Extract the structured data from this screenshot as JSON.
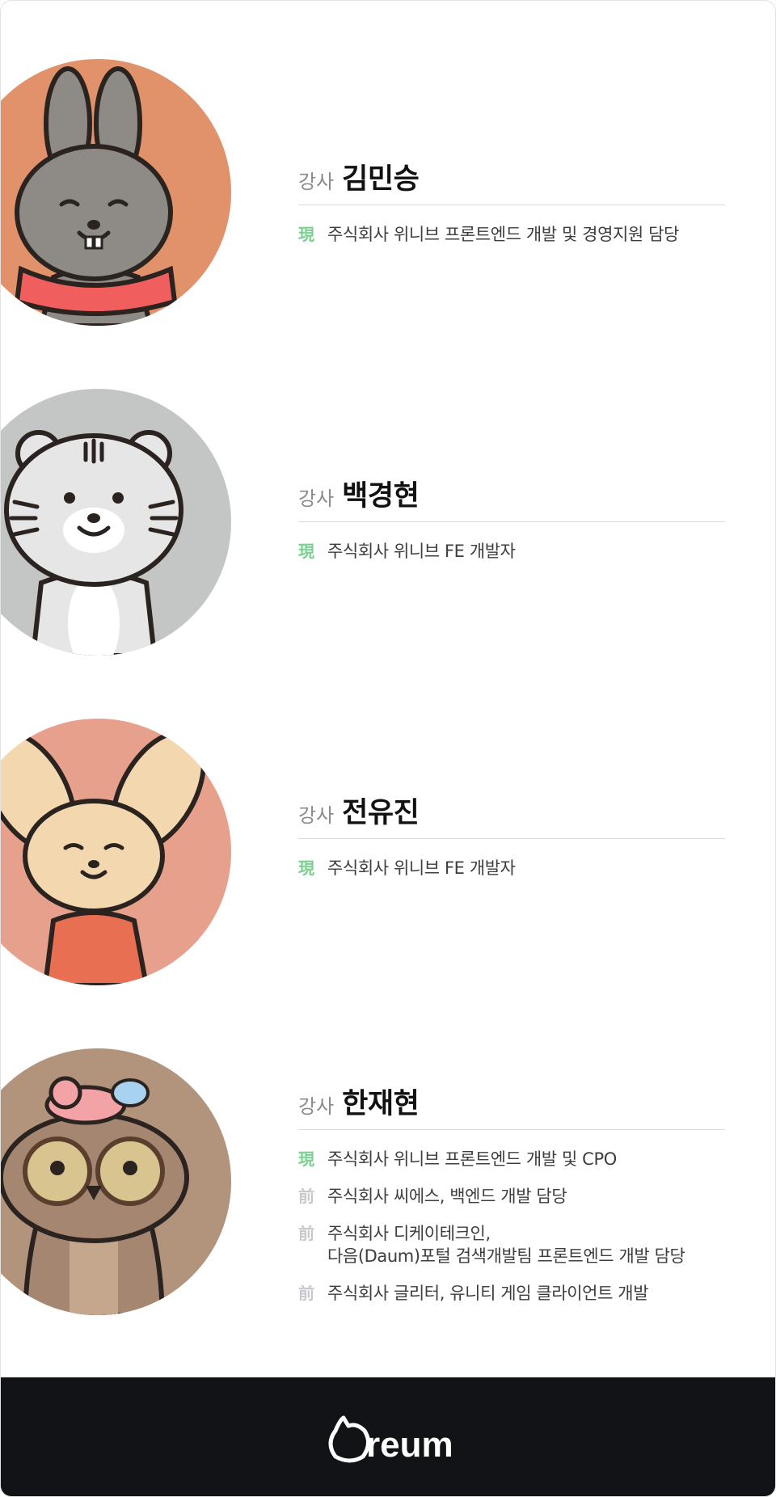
{
  "instructors": [
    {
      "role": "강사",
      "name": "김민승",
      "avatar": "rabbit-avatar",
      "careers": [
        {
          "mark": "現",
          "type": "current",
          "text": "주식회사 위니브 프론트엔드 개발 및 경영지원 담당"
        }
      ]
    },
    {
      "role": "강사",
      "name": "백경현",
      "avatar": "tiger-avatar",
      "careers": [
        {
          "mark": "現",
          "type": "current",
          "text": "주식회사 위니브 FE 개발자"
        }
      ]
    },
    {
      "role": "강사",
      "name": "전유진",
      "avatar": "fox-avatar",
      "careers": [
        {
          "mark": "現",
          "type": "current",
          "text": "주식회사 위니브 FE 개발자"
        }
      ]
    },
    {
      "role": "강사",
      "name": "한재현",
      "avatar": "owl-avatar",
      "careers": [
        {
          "mark": "現",
          "type": "current",
          "text": "주식회사 위니브 프론트엔드 개발 및 CPO"
        },
        {
          "mark": "前",
          "type": "previous",
          "text": "주식회사 씨에스, 백엔드 개발 담당"
        },
        {
          "mark": "前",
          "type": "previous",
          "text": "주식회사 디케이테크인,\n다음(Daum)포털 검색개발팀 프론트엔드 개발 담당"
        },
        {
          "mark": "前",
          "type": "previous",
          "text": "주식회사 글리터, 유니티 게임 클라이언트 개발"
        }
      ]
    }
  ],
  "footer": {
    "logo": "Oreum",
    "logo_icon": "oreum-logo"
  },
  "colors": {
    "current_mark": "#7ad18f",
    "previous_mark": "#c7c7cc",
    "footer_bg": "#121316",
    "rabbit_bg": "#e2926b",
    "tiger_bg": "#c4c5c5",
    "fox_bg": "#e6a08c",
    "owl_bg": "#b2937b"
  }
}
